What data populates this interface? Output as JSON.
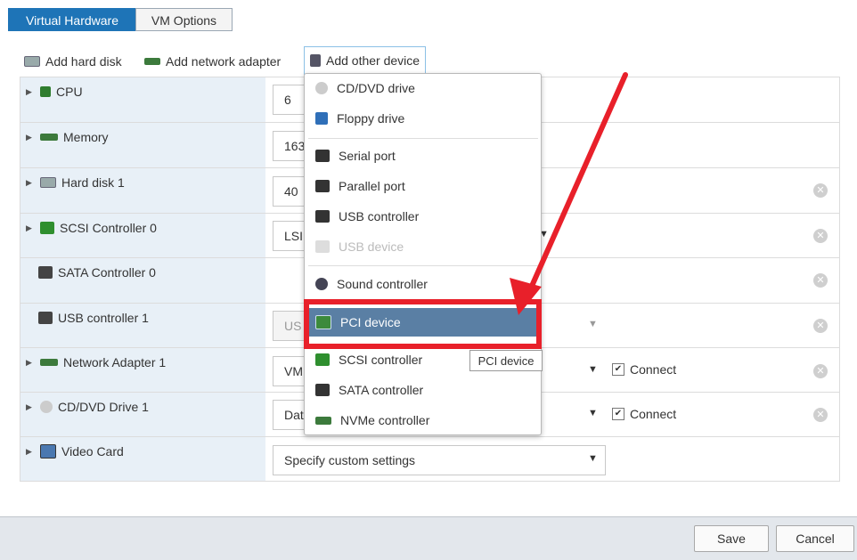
{
  "tabs": [
    {
      "label": "Virtual Hardware"
    },
    {
      "label": "VM Options"
    }
  ],
  "toolbar": {
    "add_hard_disk": "Add hard disk",
    "add_network_adapter": "Add network adapter",
    "add_other_device": "Add other device"
  },
  "rows": [
    {
      "label": "CPU",
      "value": "6"
    },
    {
      "label": "Memory",
      "value": "1638"
    },
    {
      "label": "Hard disk 1",
      "value": "40"
    },
    {
      "label": "SCSI Controller 0",
      "value": "LSI"
    },
    {
      "label": "SATA Controller 0",
      "value": ""
    },
    {
      "label": "USB controller 1",
      "value": "US"
    },
    {
      "label": "Network Adapter 1",
      "value": "VM",
      "connect": "Connect"
    },
    {
      "label": "CD/DVD Drive 1",
      "value": "Dat",
      "connect": "Connect"
    },
    {
      "label": "Video Card",
      "value": "Specify custom settings"
    }
  ],
  "menu": {
    "items": [
      {
        "label": "CD/DVD drive",
        "icon": "disc-icon"
      },
      {
        "label": "Floppy drive",
        "icon": "floppy-icon"
      },
      {
        "label": "Serial port",
        "icon": "serial-icon"
      },
      {
        "label": "Parallel port",
        "icon": "parallel-icon"
      },
      {
        "label": "USB controller",
        "icon": "usb-icon"
      },
      {
        "label": "USB device",
        "icon": "usb-device-icon",
        "disabled": true
      },
      {
        "label": "Sound controller",
        "icon": "sound-icon"
      },
      {
        "label": "PCI device",
        "icon": "pci-icon",
        "highlighted": true
      },
      {
        "label": "SCSI controller",
        "icon": "scsi-icon"
      },
      {
        "label": "SATA controller",
        "icon": "sata-icon"
      },
      {
        "label": "NVMe controller",
        "icon": "nvme-icon"
      }
    ]
  },
  "tooltip": "PCI device",
  "footer": {
    "save": "Save",
    "cancel": "Cancel"
  },
  "colors": {
    "accent": "#1e74b7",
    "highlight": "#5a7fa4",
    "annotation_red": "#e8202a"
  }
}
